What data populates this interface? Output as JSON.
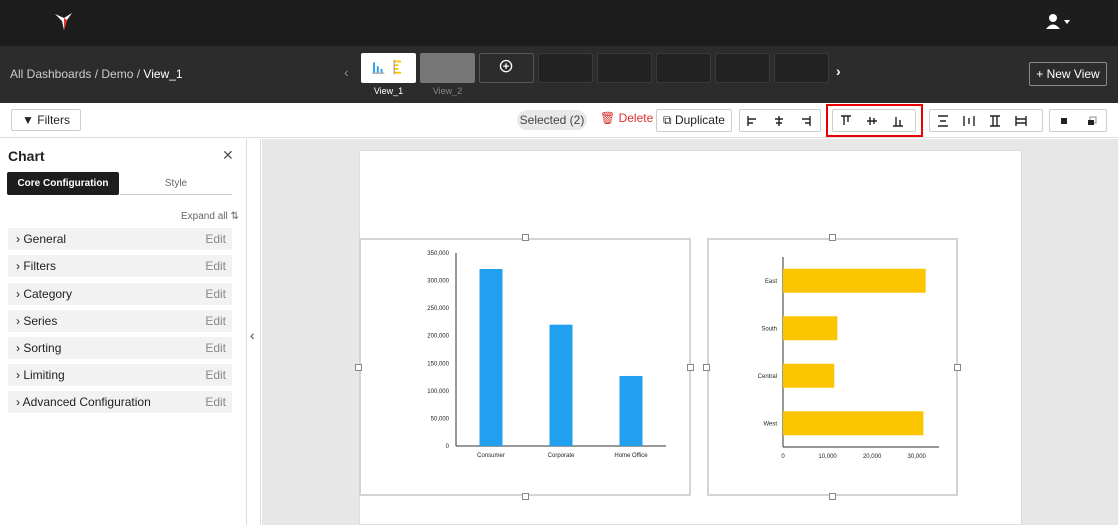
{
  "app": {
    "breadcrumb": {
      "root": "All Dashboards",
      "sep1": " / ",
      "mid": "Demo",
      "sep2": " / ",
      "current": "View_1"
    },
    "views": [
      {
        "label": "View_1"
      },
      {
        "label": "View_2"
      }
    ],
    "new_view_label": "+ New View"
  },
  "toolbar": {
    "filters_label": "Filters",
    "selected_label": "Selected (2)",
    "delete_label": "Delete",
    "duplicate_label": "Duplicate"
  },
  "panel": {
    "title": "Chart",
    "tabs": [
      {
        "label": "Core Configuration"
      },
      {
        "label": "Style"
      }
    ],
    "expand_all": "Expand all",
    "sections": [
      {
        "label": "General",
        "action": "Edit"
      },
      {
        "label": "Filters",
        "action": "Edit"
      },
      {
        "label": "Category",
        "action": "Edit"
      },
      {
        "label": "Series",
        "action": "Edit"
      },
      {
        "label": "Sorting",
        "action": "Edit"
      },
      {
        "label": "Limiting",
        "action": "Edit"
      },
      {
        "label": "Advanced Configuration",
        "action": "Edit"
      }
    ]
  },
  "colors": {
    "bar_blue": "#22a0f0",
    "bar_yellow": "#fbc500",
    "accent_red": "#e00000",
    "delete_red": "#d9302b"
  },
  "chart_data": [
    {
      "type": "bar",
      "categories": [
        "Consumer",
        "Corporate",
        "Home Office"
      ],
      "values": [
        321000,
        220000,
        127000
      ],
      "ylim": [
        0,
        350000
      ],
      "yticks": [
        "0",
        "50,000",
        "100,000",
        "150,000",
        "200,000",
        "250,000",
        "300,000",
        "350,000"
      ],
      "title": "",
      "xlabel": "",
      "ylabel": ""
    },
    {
      "type": "bar",
      "orientation": "horizontal",
      "categories": [
        "East",
        "South",
        "Central",
        "West"
      ],
      "values": [
        32000,
        12200,
        11500,
        31500
      ],
      "xlim": [
        0,
        35000
      ],
      "xticks": [
        "0",
        "10,000",
        "20,000",
        "30,000"
      ],
      "title": "",
      "xlabel": "",
      "ylabel": ""
    }
  ]
}
